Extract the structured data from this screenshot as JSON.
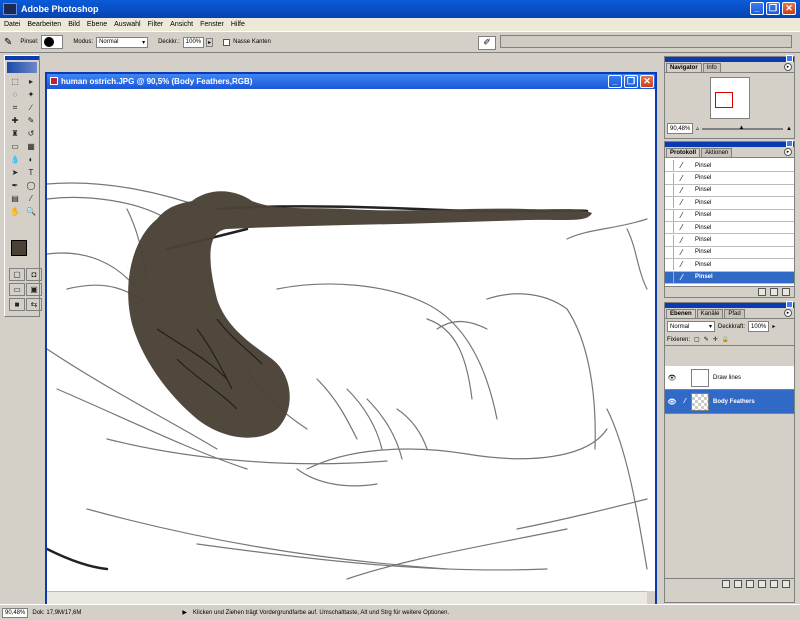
{
  "app": {
    "title": "Adobe Photoshop"
  },
  "menu": [
    "Datei",
    "Bearbeiten",
    "Bild",
    "Ebene",
    "Auswahl",
    "Filter",
    "Ansicht",
    "Fenster",
    "Hilfe"
  ],
  "options": {
    "brush_label": "Pinsel:",
    "mode_label": "Modus:",
    "mode_value": "Normal",
    "opacity_label": "Deckkr.:",
    "opacity_value": "100%",
    "wet_edges_label": "Nasse Kanten"
  },
  "document": {
    "title": "human ostrich.JPG @ 90,5% (Body Feathers,RGB)",
    "paint_color": "#4a4237"
  },
  "navigator": {
    "tabs": [
      "Navigator",
      "Info"
    ],
    "zoom": "90,48%"
  },
  "history": {
    "tabs": [
      "Protokoll",
      "Aktionen"
    ],
    "items": [
      "Pinsel",
      "Pinsel",
      "Pinsel",
      "Pinsel",
      "Pinsel",
      "Pinsel",
      "Pinsel",
      "Pinsel",
      "Pinsel",
      "Pinsel"
    ]
  },
  "layers": {
    "tabs": [
      "Ebenen",
      "Kanäle",
      "Pfad"
    ],
    "blend_mode": "Normal",
    "opacity_label": "Deckkraft:",
    "opacity_value": "100%",
    "lock_label": "Fixieren:",
    "items": [
      {
        "name": "Draw lines",
        "selected": false
      },
      {
        "name": "Body Feathers",
        "selected": true
      }
    ]
  },
  "status": {
    "zoom": "90,48%",
    "doc_size": "Dok: 17,9M/17,6M",
    "hint": "Klicken und Ziehen trägt Vordergrundfarbe auf. Umschalttaste, Alt und Strg für weitere Optionen."
  },
  "colors": {
    "foreground": "#4a4237",
    "background": "#ffffff",
    "accent": "#0a3bb0"
  }
}
